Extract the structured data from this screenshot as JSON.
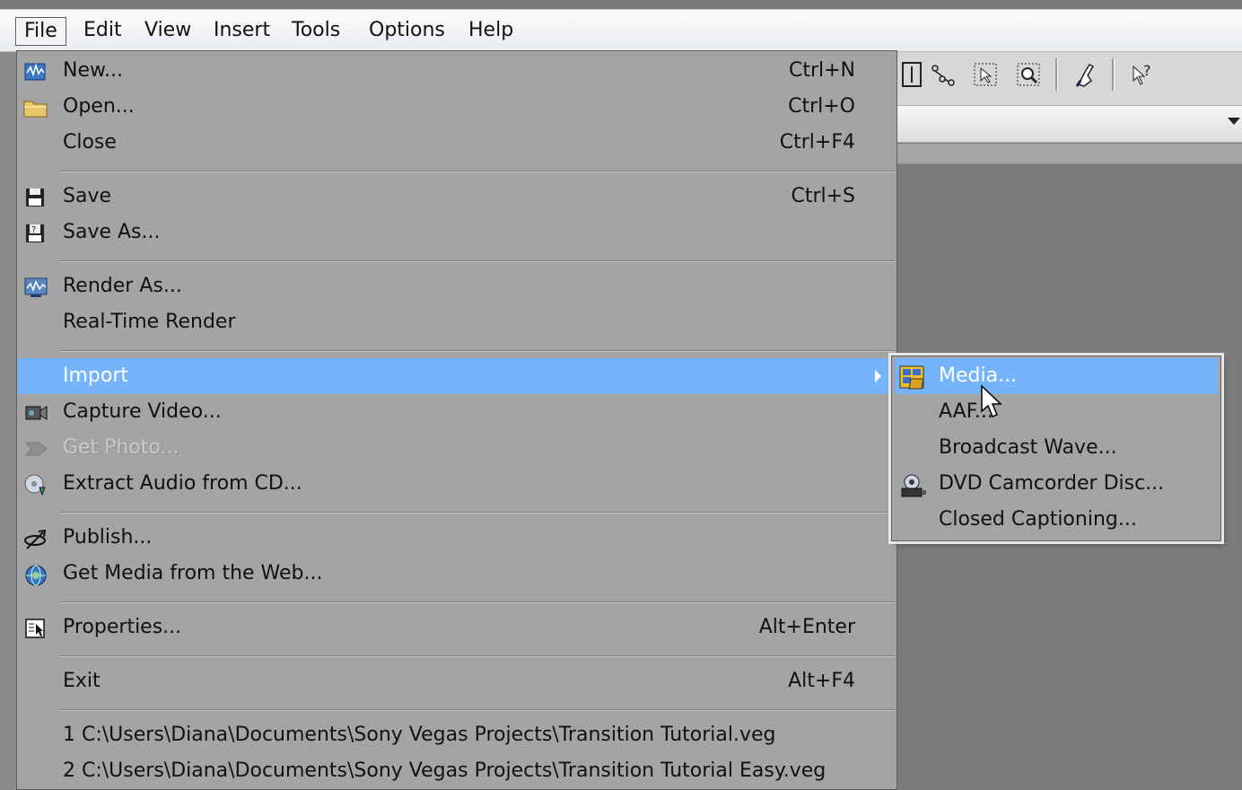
{
  "menubar": {
    "items": [
      {
        "label": "File"
      },
      {
        "label": "Edit"
      },
      {
        "label": "View"
      },
      {
        "label": "Insert"
      },
      {
        "label": "Tools"
      },
      {
        "label": "Options"
      },
      {
        "label": "Help"
      }
    ]
  },
  "file_menu": {
    "new": {
      "label": "New...",
      "shortcut": "Ctrl+N",
      "icon": "new-project-icon"
    },
    "open": {
      "label": "Open...",
      "shortcut": "Ctrl+O",
      "icon": "folder-icon"
    },
    "close": {
      "label": "Close",
      "shortcut": "Ctrl+F4"
    },
    "save": {
      "label": "Save",
      "shortcut": "Ctrl+S",
      "icon": "floppy-disk-icon"
    },
    "save_as": {
      "label": "Save As...",
      "icon": "save-as-icon"
    },
    "render_as": {
      "label": "Render As...",
      "icon": "render-icon"
    },
    "realtime_render": {
      "label": "Real-Time Render"
    },
    "import": {
      "label": "Import",
      "highlighted": true
    },
    "capture_video": {
      "label": "Capture Video...",
      "icon": "video-capture-icon"
    },
    "get_photo": {
      "label": "Get Photo...",
      "disabled": true,
      "icon": "camera-icon"
    },
    "extract_audio": {
      "label": "Extract Audio from CD...",
      "icon": "cd-extract-icon"
    },
    "publish": {
      "label": "Publish...",
      "icon": "publish-icon"
    },
    "get_media_web": {
      "label": "Get Media from the Web...",
      "icon": "globe-icon"
    },
    "properties": {
      "label": "Properties...",
      "shortcut": "Alt+Enter",
      "icon": "properties-icon"
    },
    "exit": {
      "label": "Exit",
      "shortcut": "Alt+F4"
    },
    "recent": [
      {
        "label": "1 C:\\Users\\Diana\\Documents\\Sony Vegas Projects\\Transition Tutorial.veg"
      },
      {
        "label": "2 C:\\Users\\Diana\\Documents\\Sony Vegas Projects\\Transition Tutorial Easy.veg"
      }
    ]
  },
  "import_submenu": {
    "items": [
      {
        "label": "Media...",
        "highlighted": true,
        "icon": "media-icon"
      },
      {
        "label": "AAF..."
      },
      {
        "label": "Broadcast Wave..."
      },
      {
        "label": "DVD Camcorder Disc...",
        "icon": "dvd-camcorder-icon"
      },
      {
        "label": "Closed Captioning..."
      }
    ]
  },
  "colors": {
    "highlight": "#75b3fa",
    "menu_bg": "#a4a4a4"
  }
}
